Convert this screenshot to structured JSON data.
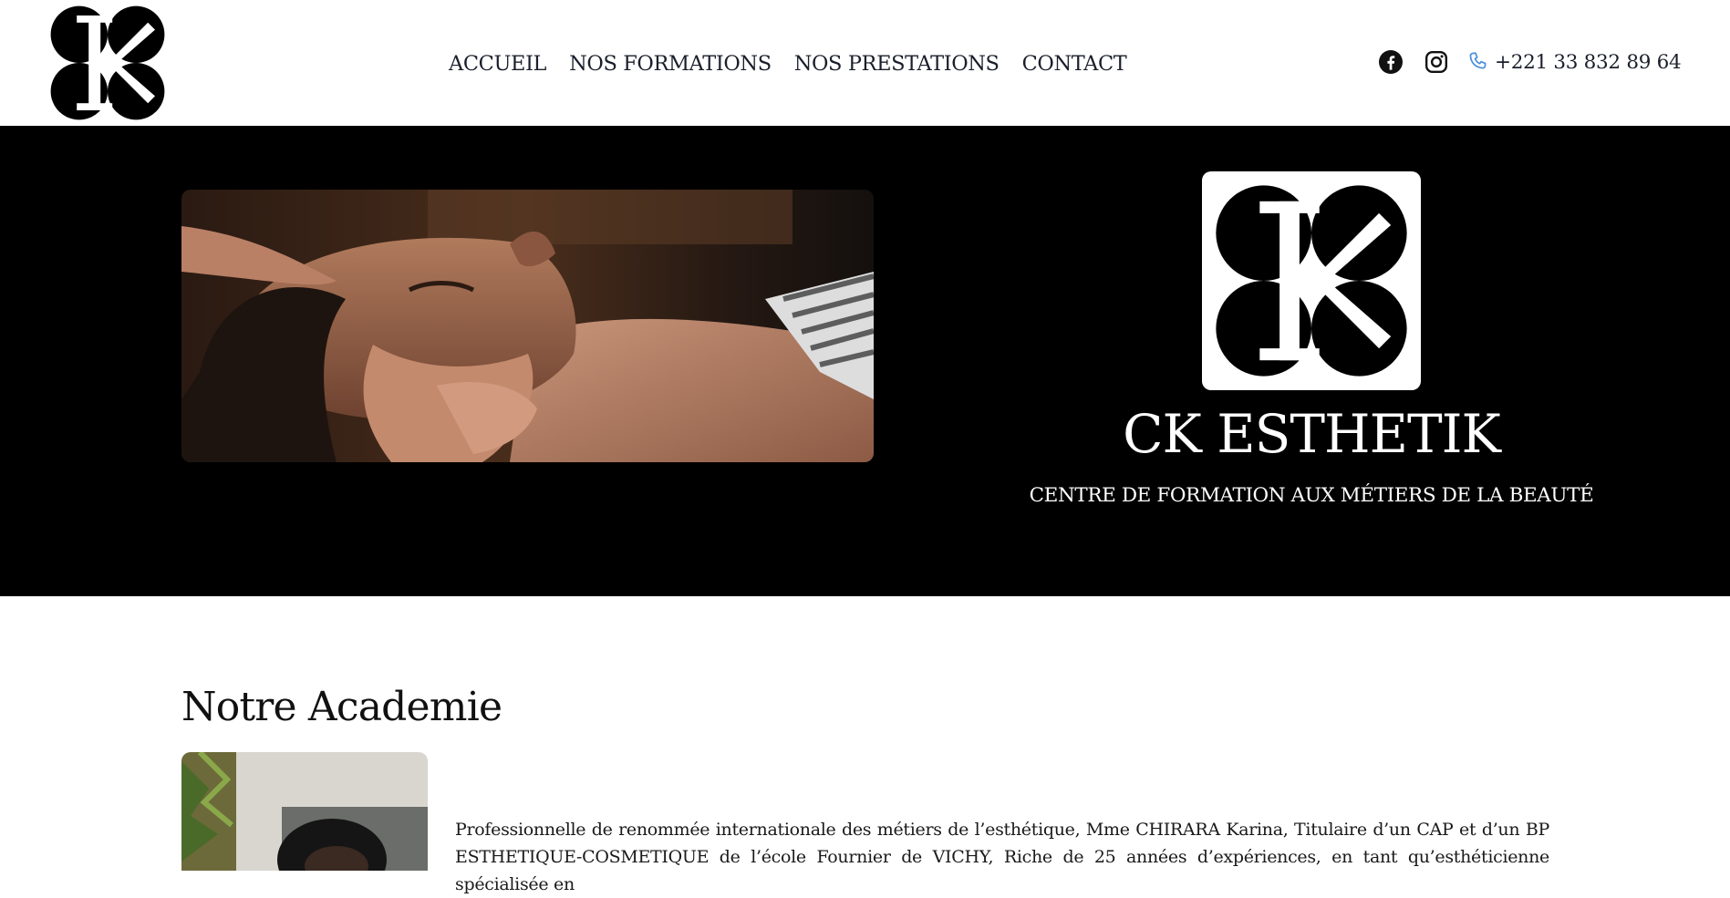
{
  "header": {
    "logo_alt": "CK ESTHETIK logo",
    "nav": [
      {
        "label": "ACCUEIL"
      },
      {
        "label": "NOS FORMATIONS"
      },
      {
        "label": "NOS PRESTATIONS"
      },
      {
        "label": "CONTACT"
      }
    ],
    "social": {
      "facebook_icon": "facebook-icon",
      "instagram_icon": "instagram-icon",
      "phone_icon": "phone-icon",
      "phone": "+221 33 832 89 64"
    }
  },
  "hero": {
    "image": "spa-massage-photo",
    "title": "CK ESTHETIK",
    "subtitle": "CENTRE DE FORMATION AUX MÉTIERS DE LA BEAUTÉ"
  },
  "academy": {
    "title": "Notre Academie",
    "image": "founder-portrait-photo",
    "text": "Professionnelle de renommée internationale des métiers de l’esthétique, Mme CHIRARA Karina, Titulaire d’un CAP et d’un BP ESTHETIQUE-COSMETIQUE de l’école Fournier de VICHY, Riche de 25 années d’expériences, en tant qu’esthéticienne spécialisée en"
  },
  "colors": {
    "hero_bg": "#000000",
    "text_dark": "#1a1f2b",
    "phone_icon": "#4a90d9"
  }
}
